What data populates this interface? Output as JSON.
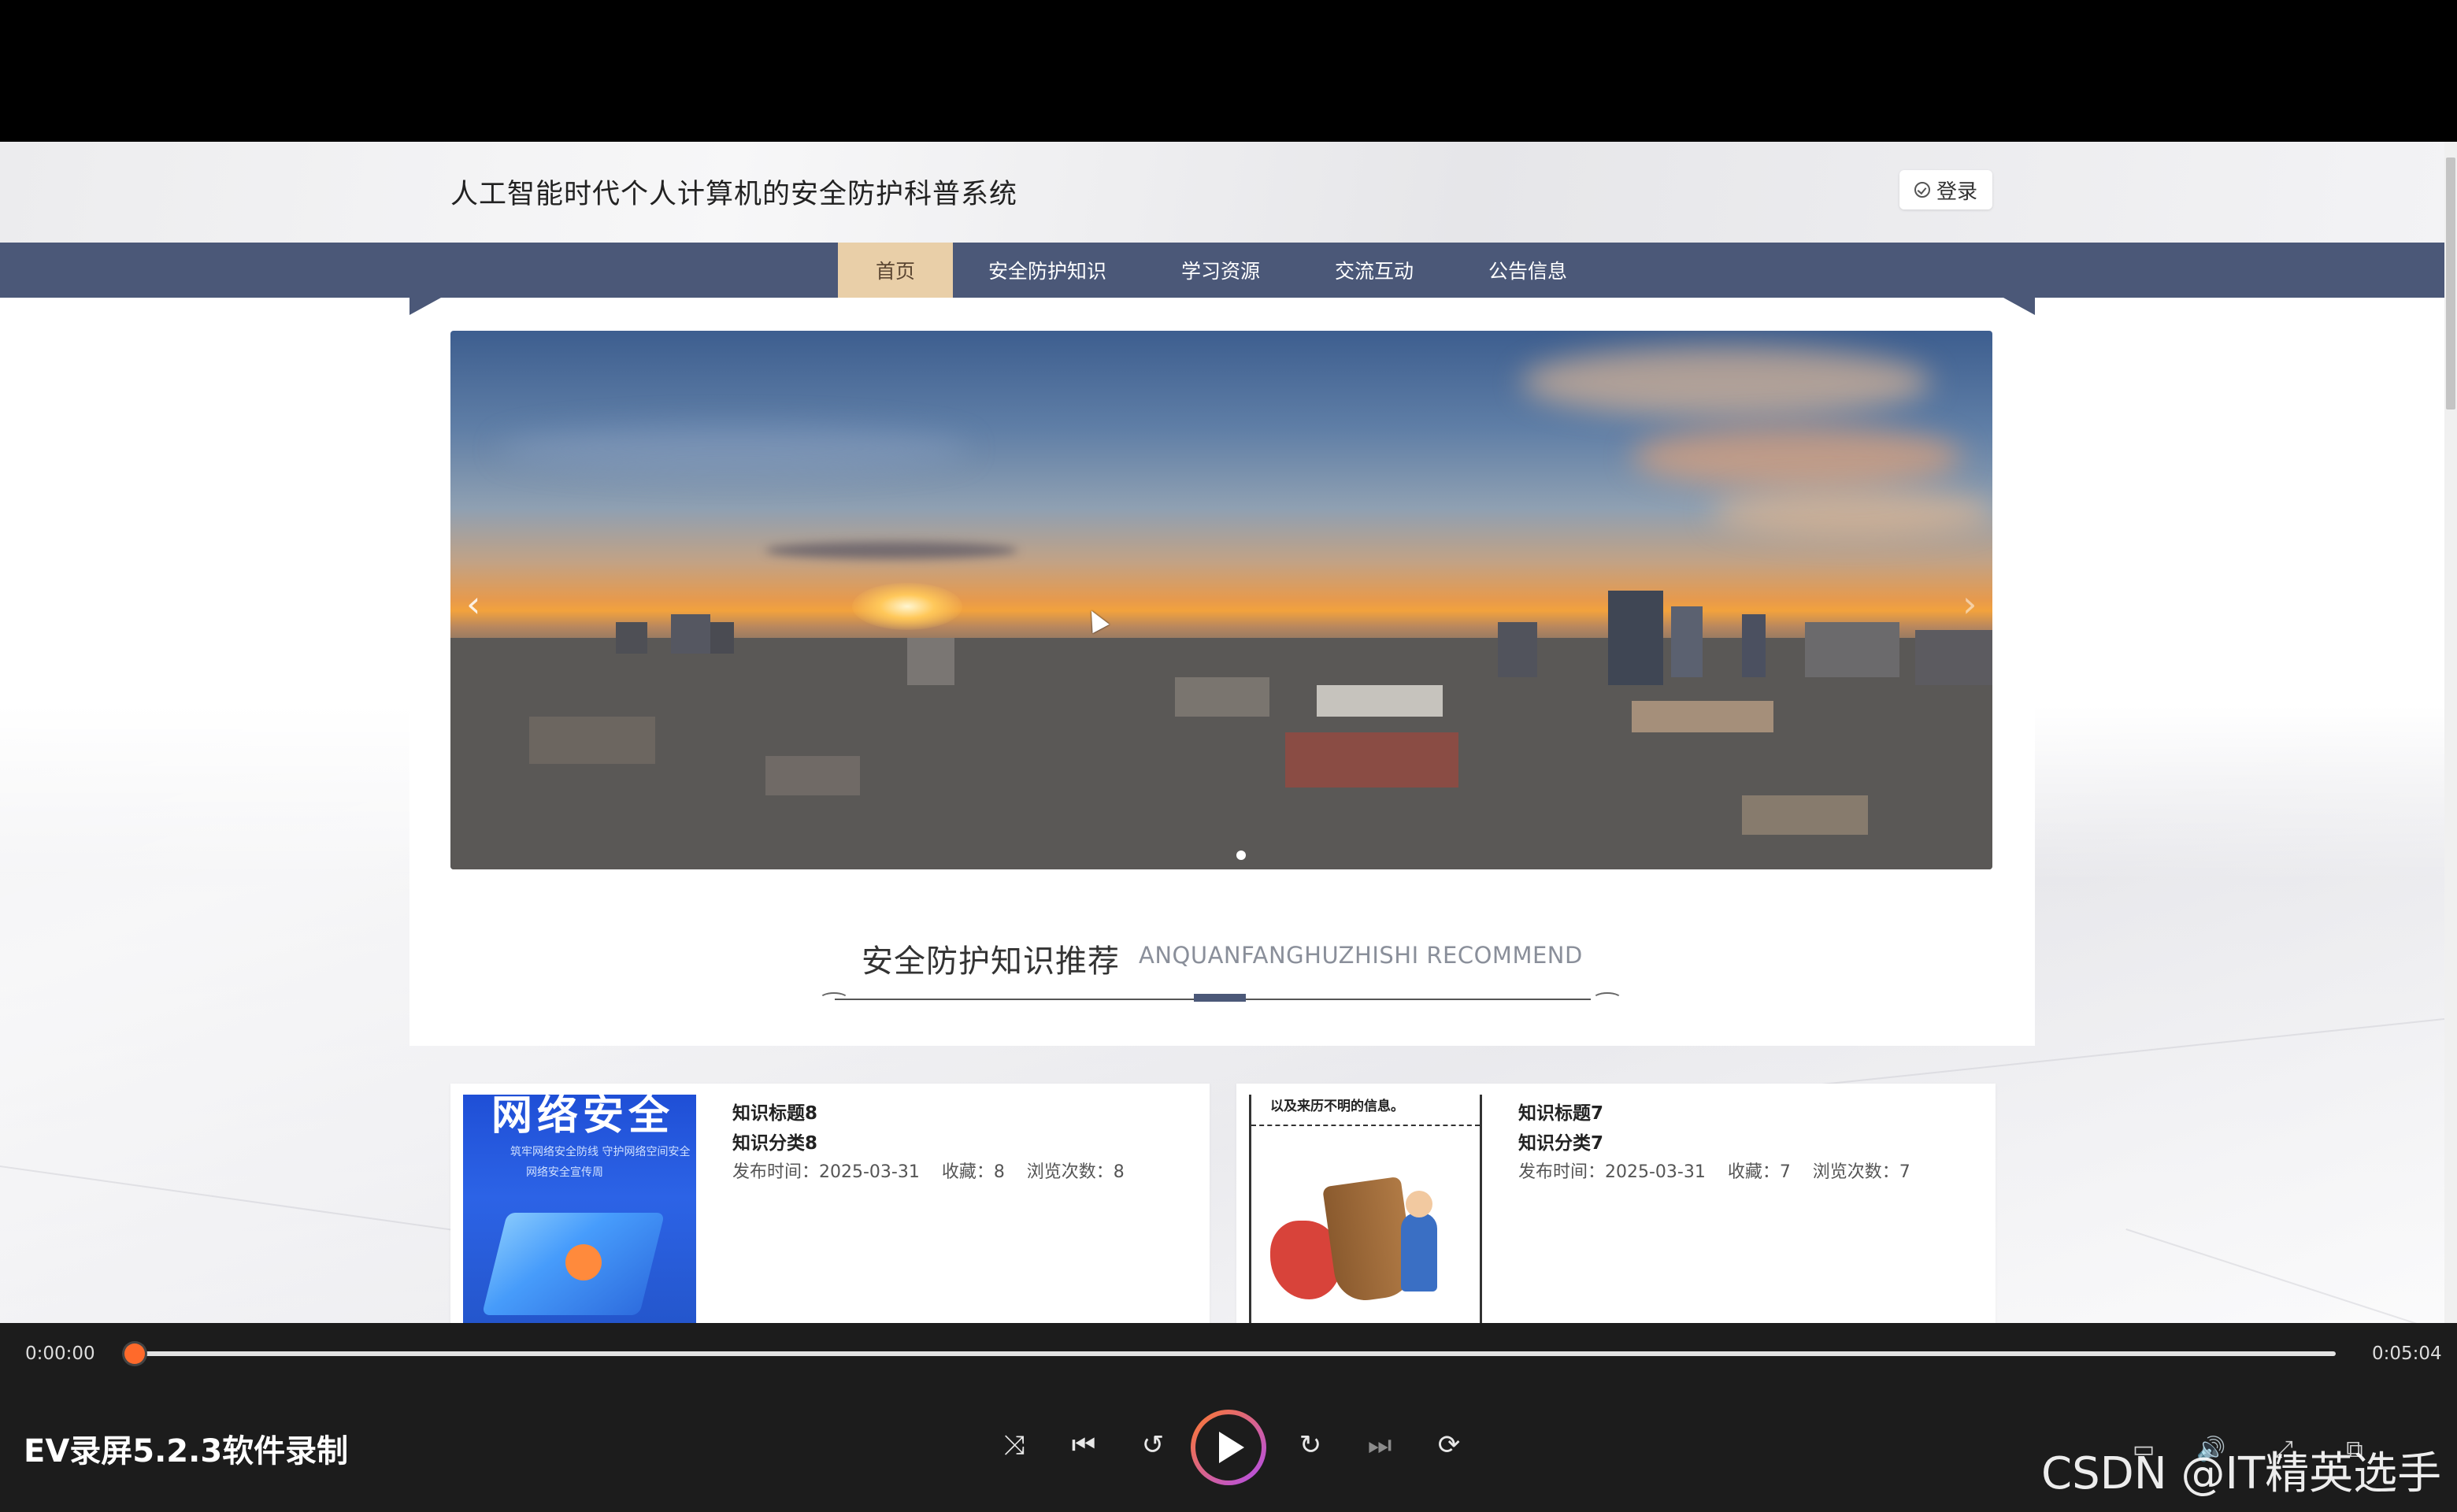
{
  "site": {
    "title": "人工智能时代个人计算机的安全防护科普系统",
    "login_label": "登录"
  },
  "nav": {
    "items": [
      {
        "label": "首页",
        "active": true
      },
      {
        "label": "安全防护知识",
        "active": false
      },
      {
        "label": "学习资源",
        "active": false
      },
      {
        "label": "交流互动",
        "active": false
      },
      {
        "label": "公告信息",
        "active": false
      }
    ]
  },
  "carousel": {
    "prev_glyph": "‹",
    "next_glyph": "›",
    "slide_index": 1
  },
  "section": {
    "title": "安全防护知识推荐",
    "subtitle": "ANQUANFANGHUZHISHI RECOMMEND"
  },
  "cards": [
    {
      "title": "知识标题8",
      "category": "知识分类8",
      "meta": "发布时间：2025-03-31    收藏：8    浏览次数：8",
      "thumb_heading": "网络安全",
      "thumb_line1": "筑牢网络安全防线 守护网络空间安全",
      "thumb_line2": "网络安全宣传周"
    },
    {
      "title": "知识标题7",
      "category": "知识分类7",
      "meta": "发布时间：2025-03-31    收藏：7    浏览次数：7",
      "thumb_text": "以及来历不明的信息。"
    }
  ],
  "player": {
    "current_time": "0:00:00",
    "total_time": "0:05:04",
    "progress": 0.0,
    "recorder_label": "EV录屏5.2.3软件录制",
    "watermark": "CSDN @IT精英选手",
    "controls": {
      "shuffle": "⤨",
      "prev": "⏮",
      "rewind": "↺",
      "forward": "↻",
      "next": "⏭",
      "loop": "⟳"
    },
    "right_controls": {
      "subtitles": "▭",
      "volume": "🔊",
      "fullscreen": "⤢",
      "pip": "⧉"
    }
  },
  "colors": {
    "nav_bg": "#4b5878",
    "nav_active": "#e9cfa8",
    "accent_orange": "#ff6a2b",
    "player_bg": "#1c1c1c"
  }
}
